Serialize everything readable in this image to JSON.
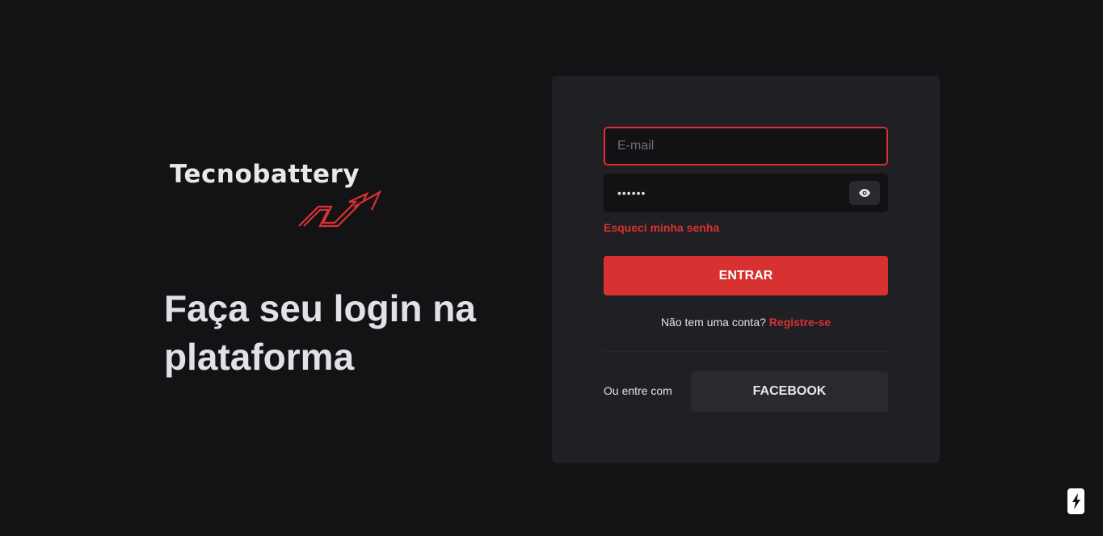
{
  "brand": {
    "name": "Tecnobattery",
    "arrow_icon": "trend-arrow-icon",
    "accent_color": "#d73131"
  },
  "headline": {
    "line1": "Faça seu login na",
    "line2": "plataforma"
  },
  "login_form": {
    "email": {
      "placeholder": "E-mail",
      "value": ""
    },
    "password": {
      "value": "••••••",
      "toggle_icon": "eye-icon"
    },
    "forgot_password": "Esqueci minha senha",
    "submit_label": "ENTRAR",
    "register_prompt": "Não tem uma conta?",
    "register_link": "Registre-se",
    "social_label": "Ou entre com",
    "facebook_label": "FACEBOOK"
  },
  "floating_badge": {
    "icon": "lightning-bolt-icon"
  },
  "colors": {
    "background": "#131316",
    "card": "#202024",
    "input": "#121214",
    "accent": "#d73131",
    "secondary_button": "#29292e"
  }
}
